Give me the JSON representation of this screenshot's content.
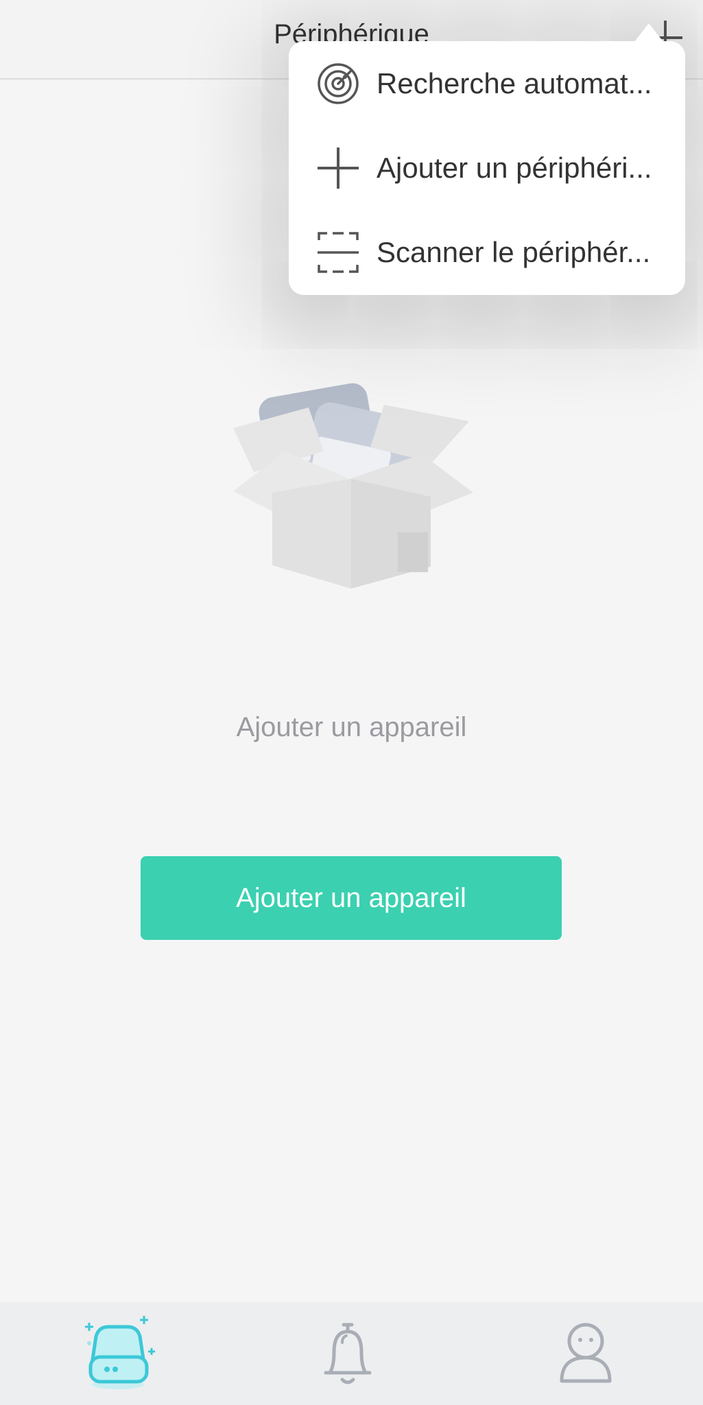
{
  "header": {
    "title": "Périphérique",
    "add_icon": "plus-icon"
  },
  "menu": {
    "items": [
      {
        "label": "Recherche automat...",
        "icon": "radar-icon"
      },
      {
        "label": "Ajouter un périphéri...",
        "icon": "plus-icon"
      },
      {
        "label": "Scanner le périphér...",
        "icon": "scan-icon"
      }
    ]
  },
  "empty_state": {
    "illustration": "open-box-illustration",
    "text": "Ajouter un appareil",
    "button_label": "Ajouter un appareil"
  },
  "tabbar": {
    "tabs": [
      {
        "icon": "device-icon",
        "active": true
      },
      {
        "icon": "bell-icon",
        "active": false
      },
      {
        "icon": "user-icon",
        "active": false
      }
    ]
  },
  "colors": {
    "accent": "#3bd0b0",
    "active_tab": "#3cc8d8",
    "inactive_tab": "#a9aeb6",
    "background": "#f5f5f6"
  }
}
